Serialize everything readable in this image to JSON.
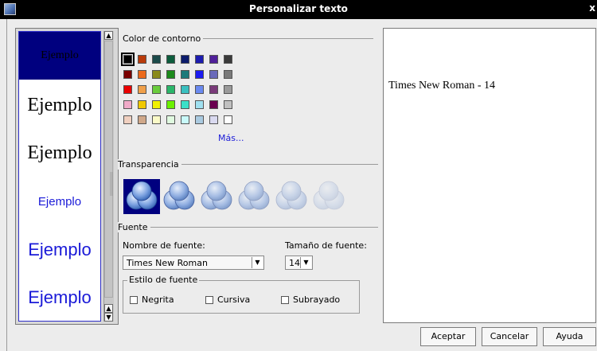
{
  "window": {
    "title": "Personalizar texto",
    "close_glyph": "x"
  },
  "samples": [
    {
      "text": "Ejemplo",
      "selected": true
    },
    {
      "text": "Ejemplo",
      "selected": false
    },
    {
      "text": "Ejemplo",
      "selected": false
    },
    {
      "text": "Ejemplo",
      "selected": false
    },
    {
      "text": "Ejemplo",
      "selected": false
    },
    {
      "text": "Ejemplo",
      "selected": false
    }
  ],
  "scroll": {
    "up": "▲",
    "down": "▼"
  },
  "outline_color": {
    "label": "Color de contorno",
    "selected": "#000000",
    "rows": [
      [
        "#000000",
        "#b93a0a",
        "#1b4a4a",
        "#0c5c3c",
        "#0c1c6c",
        "#1c1cb0",
        "#50209a",
        "#3a3a3a"
      ],
      [
        "#7a0000",
        "#ec6a1c",
        "#8a8a1c",
        "#1c8a1c",
        "#1c7a7a",
        "#1c1cf0",
        "#6a6aba",
        "#7a7a7a"
      ],
      [
        "#ea0000",
        "#f0a04a",
        "#6acc3c",
        "#2ab66a",
        "#3ac0c0",
        "#6a8af0",
        "#7a3a7a",
        "#9a9a9a"
      ],
      [
        "#f0aac8",
        "#f0c800",
        "#f0f000",
        "#6af000",
        "#3ae0c8",
        "#a0e0f0",
        "#6a0050",
        "#c0c0c0"
      ],
      [
        "#f0d0c0",
        "#d0a88a",
        "#fafac8",
        "#e0fae0",
        "#c8fafa",
        "#aacae0",
        "#dadaf0",
        "#ffffff"
      ]
    ],
    "more_label": "Más..."
  },
  "transparency": {
    "label": "Transparencia",
    "levels": [
      1.0,
      0.8,
      0.6,
      0.45,
      0.3,
      0.18
    ],
    "selected_index": 0
  },
  "font": {
    "label": "Fuente",
    "name_label": "Nombre de fuente:",
    "name_value": "Times New Roman",
    "size_label": "Tamaño de fuente:",
    "size_value": "14",
    "style_label": "Estilo de fuente",
    "bold_label": "Negrita",
    "italic_label": "Cursiva",
    "underline_label": "Subrayado"
  },
  "preview": {
    "text": "Times New Roman - 14"
  },
  "buttons": {
    "accept": "Aceptar",
    "cancel": "Cancelar",
    "help": "Ayuda"
  }
}
